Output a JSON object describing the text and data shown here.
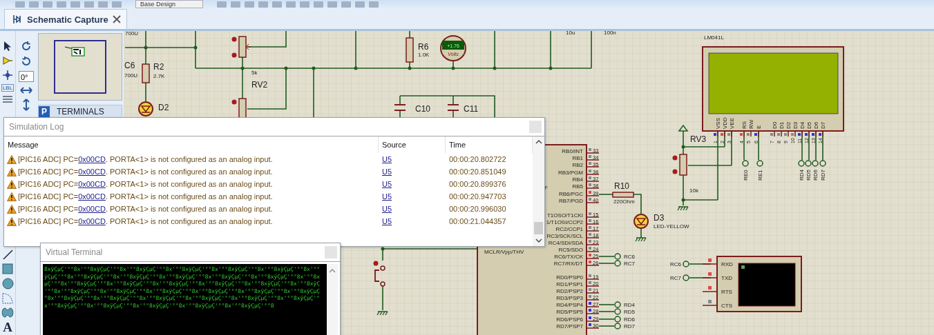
{
  "toolbar": {
    "design_select": "Base Design"
  },
  "tabs": [
    {
      "label": "Schematic Capture",
      "selected": true
    }
  ],
  "tools": {
    "label_tool": "LBL",
    "rotation": "0°",
    "text_tool": "A"
  },
  "side_panel": {
    "mode_key": "P",
    "title": "TERMINALS"
  },
  "schematic": {
    "parts": [
      {
        "ref": "C6",
        "value": "700U"
      },
      {
        "ref": "R2",
        "value": "2.7K"
      },
      {
        "ref": "D2"
      },
      {
        "ref": "RV2",
        "value": "5k"
      },
      {
        "ref": "R6",
        "value": "1.0K"
      },
      {
        "ref": "C10"
      },
      {
        "ref": "C11"
      },
      {
        "ref": "R10",
        "value": "220Ohm"
      },
      {
        "ref": "D3",
        "value": "LED-YELLOW"
      },
      {
        "ref": "RV3",
        "value": "10k"
      },
      {
        "ref": "LM041L"
      }
    ],
    "stray_values": [
      "700U",
      "10u",
      "100n"
    ],
    "voltmeter": {
      "reading": "+1.76",
      "unit": "Volts"
    },
    "mcu": {
      "fragment": "F",
      "mclr": "MCLR/Vpp/THV",
      "pins": [
        {
          "name": "RB0/INT",
          "number": "33",
          "color": "#888888"
        },
        {
          "name": "RB1",
          "number": "34",
          "color": "#888888"
        },
        {
          "name": "RB2",
          "number": "35",
          "color": "#888888"
        },
        {
          "name": "RB3/PGM",
          "number": "36",
          "color": "#888888"
        },
        {
          "name": "RB4",
          "number": "37",
          "color": "#888888"
        },
        {
          "name": "RB5",
          "number": "38",
          "color": "#888888"
        },
        {
          "name": "RB6/PGC",
          "number": "39",
          "color": "#e04848"
        },
        {
          "name": "RB7/PGD",
          "number": "40",
          "color": "#888888"
        },
        {
          "name": "T1OSO/T1CKI",
          "number": "15",
          "color": "#888888"
        },
        {
          "name": "1/T1OSI/CCP2",
          "number": "16",
          "color": "#888888"
        },
        {
          "name": "RC2/CCP1",
          "number": "17",
          "color": "#888888"
        },
        {
          "name": "RC3/SCK/SCL",
          "number": "18",
          "color": "#888888"
        },
        {
          "name": "RC4/SDI/SDA",
          "number": "23",
          "color": "#888888"
        },
        {
          "name": "RC5/SDO",
          "number": "24",
          "color": "#888888"
        },
        {
          "name": "RC6/TX/CK",
          "number": "25",
          "color": "#e04848"
        },
        {
          "name": "RC7/RX/DT",
          "number": "26",
          "color": "#e04848"
        },
        {
          "name": "RD0/PSP0",
          "number": "19",
          "color": "#888888"
        },
        {
          "name": "RD1/PSP1",
          "number": "20",
          "color": "#888888"
        },
        {
          "name": "RD2/PSP2",
          "number": "21",
          "color": "#888888"
        },
        {
          "name": "RD3/PSP3",
          "number": "22",
          "color": "#888888"
        },
        {
          "name": "RD4/PSP4",
          "number": "27",
          "color": "#3333dd"
        },
        {
          "name": "RD5/PSP5",
          "number": "28",
          "color": "#3333dd"
        },
        {
          "name": "RD6/PSP6",
          "number": "29",
          "color": "#3333dd"
        },
        {
          "name": "RD7/PSP7",
          "number": "30",
          "color": "#3333dd"
        }
      ]
    },
    "lcd": {
      "pins": [
        {
          "name": "VSS",
          "number": "1",
          "color": "#3333dd"
        },
        {
          "name": "VDD",
          "number": "2",
          "color": "#e04848"
        },
        {
          "name": "VEE",
          "number": "3",
          "color": "#888888"
        },
        {
          "name": "RS",
          "number": "4",
          "color": "#e04848"
        },
        {
          "name": "RW",
          "number": "5",
          "color": "#888888"
        },
        {
          "name": "E",
          "number": "6",
          "color": "#3333dd"
        },
        {
          "name": "D0",
          "number": "7",
          "color": "#888888"
        },
        {
          "name": "D1",
          "number": "8",
          "color": "#888888"
        },
        {
          "name": "D2",
          "number": "9",
          "color": "#888888"
        },
        {
          "name": "D3",
          "number": "10",
          "color": "#888888"
        },
        {
          "name": "D4",
          "number": "11",
          "color": "#3333dd"
        },
        {
          "name": "D5",
          "number": "12",
          "color": "#3333dd"
        },
        {
          "name": "D6",
          "number": "13",
          "color": "#3333dd"
        },
        {
          "name": "D7",
          "number": "14",
          "color": "#3333dd"
        }
      ]
    },
    "terminals": [
      "RE0",
      "RE1",
      "RD4",
      "RD5",
      "RD6",
      "RD7",
      "RC6",
      "RC7",
      "RD4",
      "RD5",
      "RD6",
      "RD7",
      "RC6",
      "RC7"
    ],
    "virtual_terminal": {
      "pins": [
        {
          "name": "RXD",
          "color": "#e04848"
        },
        {
          "name": "TXD",
          "color": "#e04848"
        },
        {
          "name": "RTS",
          "color": "#e04848"
        },
        {
          "name": "CTS",
          "color": "#888888"
        }
      ]
    }
  },
  "simulation_log": {
    "title": "Simulation Log",
    "columns": [
      "Message",
      "Source",
      "Time"
    ],
    "rows": [
      {
        "kind": "warning",
        "prefix": "[PIC16 ADC] PC=",
        "address": "0x00CD",
        "suffix": ". PORTA<1> is not configured as an analog input.",
        "source": "U5",
        "time": "00:00:20.802722"
      },
      {
        "kind": "warning",
        "prefix": "[PIC16 ADC] PC=",
        "address": "0x00CD",
        "suffix": ". PORTA<1> is not configured as an analog input.",
        "source": "U5",
        "time": "00:00:20.851049"
      },
      {
        "kind": "warning",
        "prefix": "[PIC16 ADC] PC=",
        "address": "0x00CD",
        "suffix": ". PORTA<1> is not configured as an analog input.",
        "source": "U5",
        "time": "00:00:20.899376"
      },
      {
        "kind": "warning",
        "prefix": "[PIC16 ADC] PC=",
        "address": "0x00CD",
        "suffix": ". PORTA<1> is not configured as an analog input.",
        "source": "U5",
        "time": "00:00:20.947703"
      },
      {
        "kind": "warning",
        "prefix": "[PIC16 ADC] PC=",
        "address": "0x00CD",
        "suffix": ". PORTA<1> is not configured as an analog input.",
        "source": "U5",
        "time": "00:00:20.996030"
      },
      {
        "kind": "warning",
        "prefix": "[PIC16 ADC] PC=",
        "address": "0x00CD",
        "suffix": ". PORTA<1> is not configured as an analog input.",
        "source": "U5",
        "time": "00:00:21.044357"
      }
    ]
  },
  "virtual_terminal_window": {
    "title": "Virtual Terminal",
    "lines": [
      "8xÿÇµÇ'°°8x'°°8xÿÇµÇ'°°8x'°°8xÿÇµÇ'°°8x'°°8xÿÇµÇ'°°8x'°°8xÿÇµÇ'°°8x'°°8xÿÇµÇ'°°8x'°°",
      "ÿÇµÇ'°°8x'°°8xÿÇµÇ'°°8x'°°8xÿÇµÇ'°°8x'°°8xÿÇµÇ'°°8x'°°8xÿÇµÇ'°°8x'°°8xÿÇµÇ'°°8x'°°8x",
      "µÇ'°°8x'°°8xÿÇµÇ'°°8x'°°8xÿÇµÇ'°°8x'°°8xÿÇµÇ'°°8x'°°8xÿÇµÇ'°°8x'°°8xÿÇµÇ'°°8x'°°8xÿÇ",
      "'°°8x'°°8xÿÇµÇ'°°8x'°°8xÿÇµÇ'°°8x'°°8xÿÇµÇ'°°8x'°°8xÿÇµÇ'°°8x'°°8xÿÇµÇ'°°8x'°°8xÿÇµÇ",
      "°8x'°°8xÿÇµÇ'°°8x'°°8xÿÇµÇ'°°8x'°°8xÿÇµÇ'°°8x'°°8xÿÇµÇ'°°8x'°°8xÿÇµÇ'°°8x'°°8xÿÇµÇ'°",
      "x'°°8xÿÇµÇ'°°8x'°°8xÿÇµÇ'°°8x'°°8xÿÇµÇ'°°8x'°°8xÿÇµÇ'°°8x'°°8xÿÇµÇ'°°8"
    ]
  }
}
